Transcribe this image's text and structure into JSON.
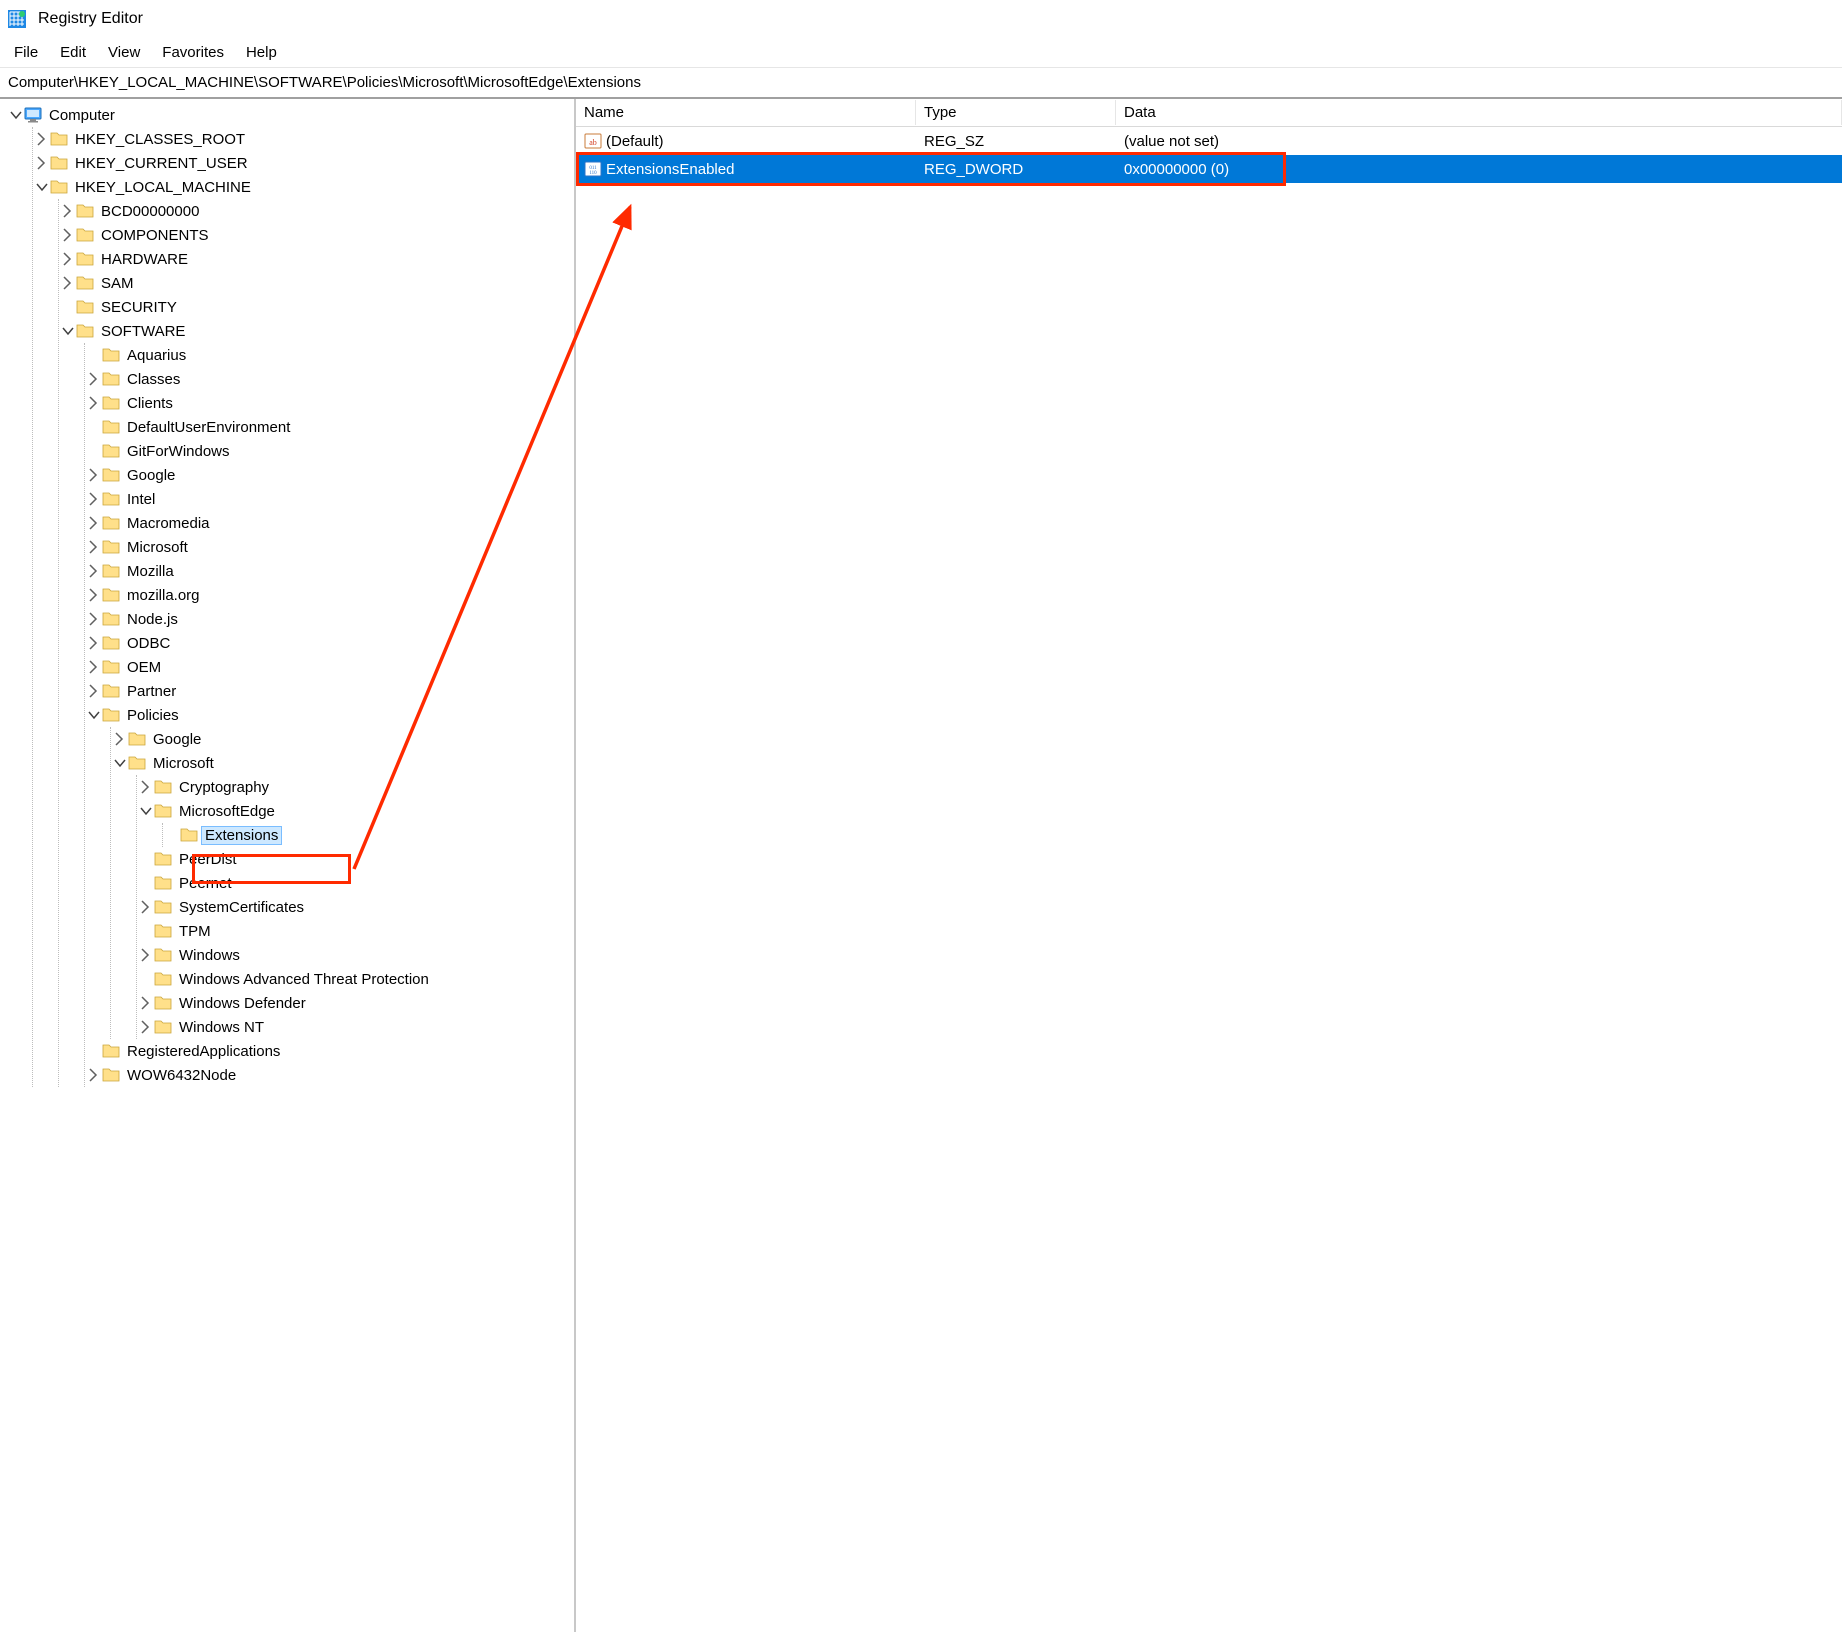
{
  "window": {
    "title": "Registry Editor"
  },
  "menu": {
    "file": "File",
    "edit": "Edit",
    "view": "View",
    "favorites": "Favorites",
    "help": "Help"
  },
  "address": {
    "path": "Computer\\HKEY_LOCAL_MACHINE\\SOFTWARE\\Policies\\Microsoft\\MicrosoftEdge\\Extensions"
  },
  "tree": {
    "root": "Computer",
    "hives": {
      "hkcr": "HKEY_CLASSES_ROOT",
      "hkcu": "HKEY_CURRENT_USER",
      "hklm": "HKEY_LOCAL_MACHINE"
    },
    "hklm_children": {
      "bcd": "BCD00000000",
      "components": "COMPONENTS",
      "hardware": "HARDWARE",
      "sam": "SAM",
      "security": "SECURITY",
      "software": "SOFTWARE"
    },
    "software_children": {
      "aquarius": "Aquarius",
      "classes": "Classes",
      "clients": "Clients",
      "defaultuserenvironment": "DefaultUserEnvironment",
      "gitforwindows": "GitForWindows",
      "google": "Google",
      "intel": "Intel",
      "macromedia": "Macromedia",
      "microsoft": "Microsoft",
      "mozilla": "Mozilla",
      "mozillaorg": "mozilla.org",
      "nodejs": "Node.js",
      "odbc": "ODBC",
      "oem": "OEM",
      "partner": "Partner",
      "policies": "Policies",
      "registeredapplications": "RegisteredApplications",
      "wow6432node": "WOW6432Node"
    },
    "policies_children": {
      "google": "Google",
      "microsoft": "Microsoft"
    },
    "policies_microsoft_children": {
      "cryptography": "Cryptography",
      "microsoftedge": "MicrosoftEdge",
      "peerdist": "PeerDist",
      "peernet": "Peernet",
      "systemcertificates": "SystemCertificates",
      "tpm": "TPM",
      "windows": "Windows",
      "watp": "Windows Advanced Threat Protection",
      "windowsdefender": "Windows Defender",
      "windowsnt": "Windows NT"
    },
    "microsoftedge_children": {
      "extensions": "Extensions"
    }
  },
  "details": {
    "headers": {
      "name": "Name",
      "type": "Type",
      "data": "Data"
    },
    "rows": [
      {
        "icon": "string",
        "name": "(Default)",
        "type": "REG_SZ",
        "data": "(value not set)",
        "selected": false
      },
      {
        "icon": "dword",
        "name": "ExtensionsEnabled",
        "type": "REG_DWORD",
        "data": "0x00000000 (0)",
        "selected": true
      }
    ]
  }
}
